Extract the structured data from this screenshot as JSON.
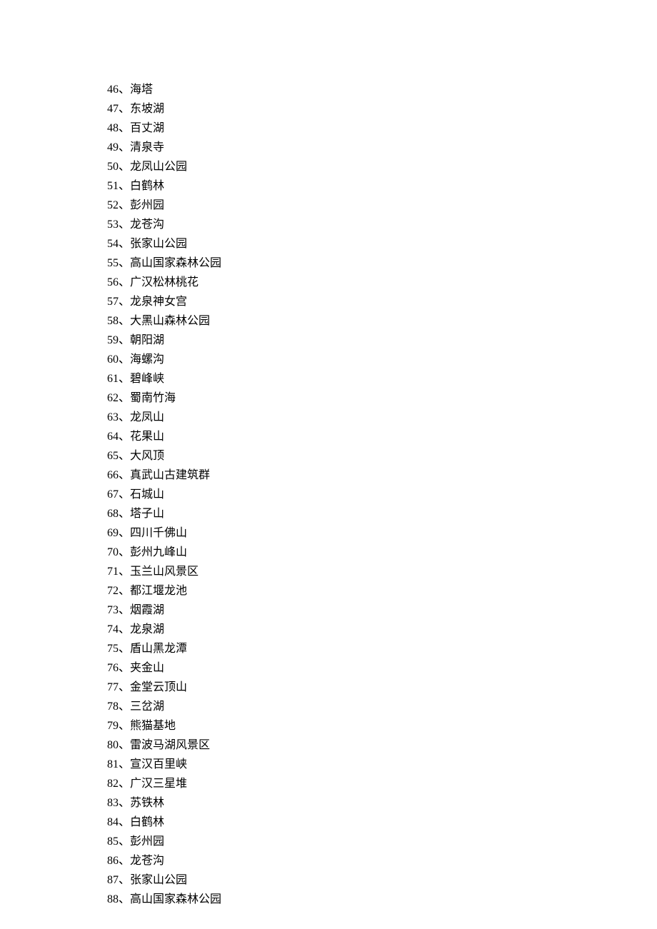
{
  "separator": "、",
  "items": [
    {
      "n": "46",
      "name": "海塔"
    },
    {
      "n": "47",
      "name": "东坡湖"
    },
    {
      "n": "48",
      "name": "百丈湖"
    },
    {
      "n": "49",
      "name": "清泉寺"
    },
    {
      "n": "50",
      "name": "龙凤山公园"
    },
    {
      "n": "51",
      "name": "白鹤林"
    },
    {
      "n": "52",
      "name": "彭州园"
    },
    {
      "n": "53",
      "name": "龙苍沟"
    },
    {
      "n": "54",
      "name": "张家山公园"
    },
    {
      "n": "55",
      "name": "高山国家森林公园"
    },
    {
      "n": "56",
      "name": "广汉松林桃花"
    },
    {
      "n": "57",
      "name": "龙泉神女宫"
    },
    {
      "n": "58",
      "name": "大黑山森林公园"
    },
    {
      "n": "59",
      "name": "朝阳湖"
    },
    {
      "n": "60",
      "name": "海螺沟"
    },
    {
      "n": "61",
      "name": "碧峰峡"
    },
    {
      "n": "62",
      "name": "蜀南竹海"
    },
    {
      "n": "63",
      "name": "龙凤山"
    },
    {
      "n": "64",
      "name": "花果山"
    },
    {
      "n": "65",
      "name": "大风顶"
    },
    {
      "n": "66",
      "name": "真武山古建筑群"
    },
    {
      "n": "67",
      "name": "石城山"
    },
    {
      "n": "68",
      "name": "塔子山"
    },
    {
      "n": "69",
      "name": "四川千佛山"
    },
    {
      "n": "70",
      "name": "彭州九峰山"
    },
    {
      "n": "71",
      "name": "玉兰山风景区"
    },
    {
      "n": "72",
      "name": "都江堰龙池"
    },
    {
      "n": "73",
      "name": "烟霞湖"
    },
    {
      "n": "74",
      "name": "龙泉湖"
    },
    {
      "n": "75",
      "name": "盾山黑龙潭"
    },
    {
      "n": "76",
      "name": "夹金山"
    },
    {
      "n": "77",
      "name": "金堂云顶山"
    },
    {
      "n": "78",
      "name": "三岔湖"
    },
    {
      "n": "79",
      "name": "熊猫基地"
    },
    {
      "n": "80",
      "name": "雷波马湖风景区"
    },
    {
      "n": "81",
      "name": "宣汉百里峡"
    },
    {
      "n": "82",
      "name": "广汉三星堆"
    },
    {
      "n": "83",
      "name": "苏铁林"
    },
    {
      "n": "84",
      "name": "白鹤林"
    },
    {
      "n": "85",
      "name": "彭州园"
    },
    {
      "n": "86",
      "name": "龙苍沟"
    },
    {
      "n": "87",
      "name": "张家山公园"
    },
    {
      "n": "88",
      "name": "高山国家森林公园"
    }
  ]
}
